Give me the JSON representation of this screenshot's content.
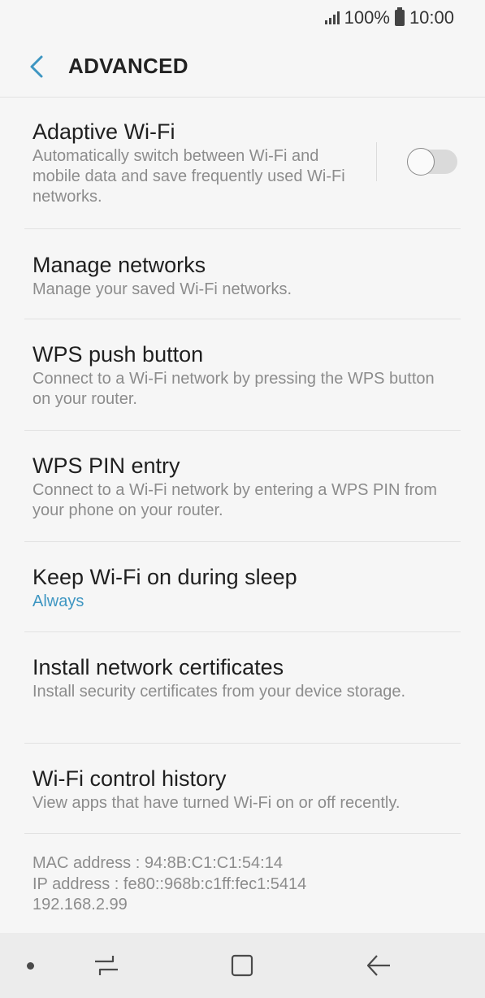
{
  "status_bar": {
    "battery_percent": "100%",
    "time": "10:00",
    "icons": [
      "signal-icon",
      "battery-icon"
    ]
  },
  "header": {
    "title": "ADVANCED",
    "back_icon": "back-arrow-icon"
  },
  "items": [
    {
      "title": "Adaptive Wi-Fi",
      "subtitle": "Automatically switch between Wi-Fi and mobile data and save frequently used Wi-Fi networks.",
      "toggle": {
        "on": false
      }
    },
    {
      "title": "Manage networks",
      "subtitle": "Manage your saved Wi-Fi networks."
    },
    {
      "title": "WPS push button",
      "subtitle": "Connect to a Wi-Fi network by pressing the WPS button on your router."
    },
    {
      "title": "WPS PIN entry",
      "subtitle": "Connect to a Wi-Fi network by entering a WPS PIN from your phone on your router."
    },
    {
      "title": "Keep Wi-Fi on during sleep",
      "subtitle": "Always"
    },
    {
      "title": "Install network certificates",
      "subtitle": "Install security certificates from your device storage."
    },
    {
      "title": "Wi-Fi control history",
      "subtitle": "View apps that have turned Wi-Fi on or off recently."
    }
  ],
  "info": {
    "mac": "MAC address : 94:8B:C1:C1:54:14",
    "ip": "IP address : fe80::968b:c1ff:fec1:5414",
    "ip4": "192.168.2.99"
  },
  "colors": {
    "accent": "#3e96c2",
    "background": "#f6f6f6",
    "nav_bar": "#ececec"
  },
  "nav_bar": {
    "icons": [
      "nav-dot-icon",
      "recent-apps-icon",
      "home-icon",
      "back-icon"
    ]
  }
}
